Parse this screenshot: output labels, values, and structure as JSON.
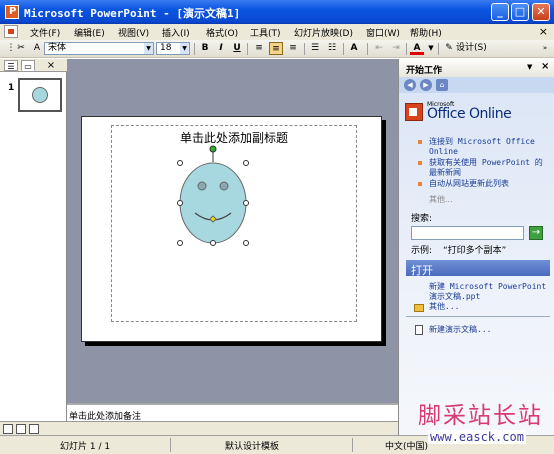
{
  "window": {
    "title": "Microsoft PowerPoint - [演示文稿1]",
    "minimize": "_",
    "maximize": "□",
    "close": "✕"
  },
  "menubar": {
    "items": [
      "文件(F)",
      "编辑(E)",
      "视图(V)",
      "插入(I)",
      "格式(O)",
      "工具(T)",
      "幻灯片放映(D)",
      "窗口(W)",
      "帮助(H)"
    ],
    "doc_close": "×"
  },
  "toolbar": {
    "font_name": "宋体",
    "font_size": "18",
    "bold": "B",
    "italic": "I",
    "underline": "U",
    "font_grow": "A",
    "font_color": "A",
    "design_label": "设计(S)"
  },
  "left_panel": {
    "tab_close": "×",
    "slide_number": "1"
  },
  "slide": {
    "subtitle_placeholder": "单击此处添加副标题"
  },
  "notes": {
    "placeholder": "单击此处添加备注"
  },
  "task_pane": {
    "title": "开始工作",
    "dropdown": "▼",
    "close": "×",
    "office_small": "Microsoft",
    "office_online": "Office Online",
    "links": [
      "连接到 Microsoft Office Online",
      "获取有关使用 PowerPoint 的最新新闻",
      "自动从网站更新此列表"
    ],
    "more": "其他...",
    "search_label": "搜索:",
    "search_value": "",
    "go": "→",
    "example_label": "示例:",
    "example_value": "“打印多个副本”",
    "open_section": "打开",
    "open_file": "新建 Microsoft PowerPoint 演示文稿.ppt",
    "open_more": "其他...",
    "new_presentation": "新建演示文稿..."
  },
  "statusbar": {
    "slide_info": "幻灯片 1 / 1",
    "template": "默认设计模板",
    "language": "中文(中国)"
  },
  "watermark": {
    "text": "脚采站长站",
    "url": "www.easck.com"
  },
  "colors": {
    "titlebar": "#0a55e0",
    "face_fill": "#a8d8df",
    "slide_area": "#8e93a5",
    "watermark": "#d83a78"
  }
}
